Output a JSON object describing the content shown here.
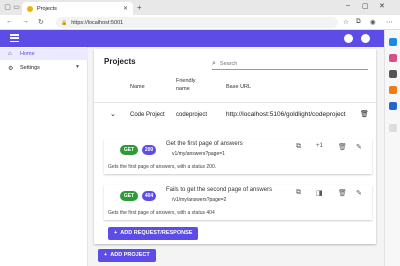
{
  "browser": {
    "tab_title": "Projects",
    "url": "https://localhost:5001"
  },
  "sidebar": {
    "items": [
      {
        "label": "Home",
        "icon": "home-icon"
      },
      {
        "label": "Settings",
        "icon": "gear-icon"
      }
    ]
  },
  "page": {
    "title": "Projects",
    "search_placeholder": "Search",
    "columns": {
      "name": "Name",
      "friendly": "Friendly name",
      "base_url": "Base URL"
    }
  },
  "project": {
    "name": "Code Project",
    "friendly_name": "codeproject",
    "base_url": "http://localhost:5106/goldlight/codeproject"
  },
  "requests": [
    {
      "method": "GET",
      "status": "200",
      "title": "Get the first page of answers",
      "path": "v1/my/answers?page=1",
      "count": "+1",
      "description": "Gets the first page of answers, with a status 200."
    },
    {
      "method": "GET",
      "status": "404",
      "title": "Fails to get the second page of answers",
      "path": "/v1/my/answers?page=2",
      "description": "Gets the first page of answers, with a status 404"
    }
  ],
  "buttons": {
    "add_request": "ADD REQUEST/RESPONSE",
    "add_project": "ADD PROJECT"
  },
  "colors": {
    "primary": "#5d4de6",
    "get": "#2e9b3a"
  }
}
